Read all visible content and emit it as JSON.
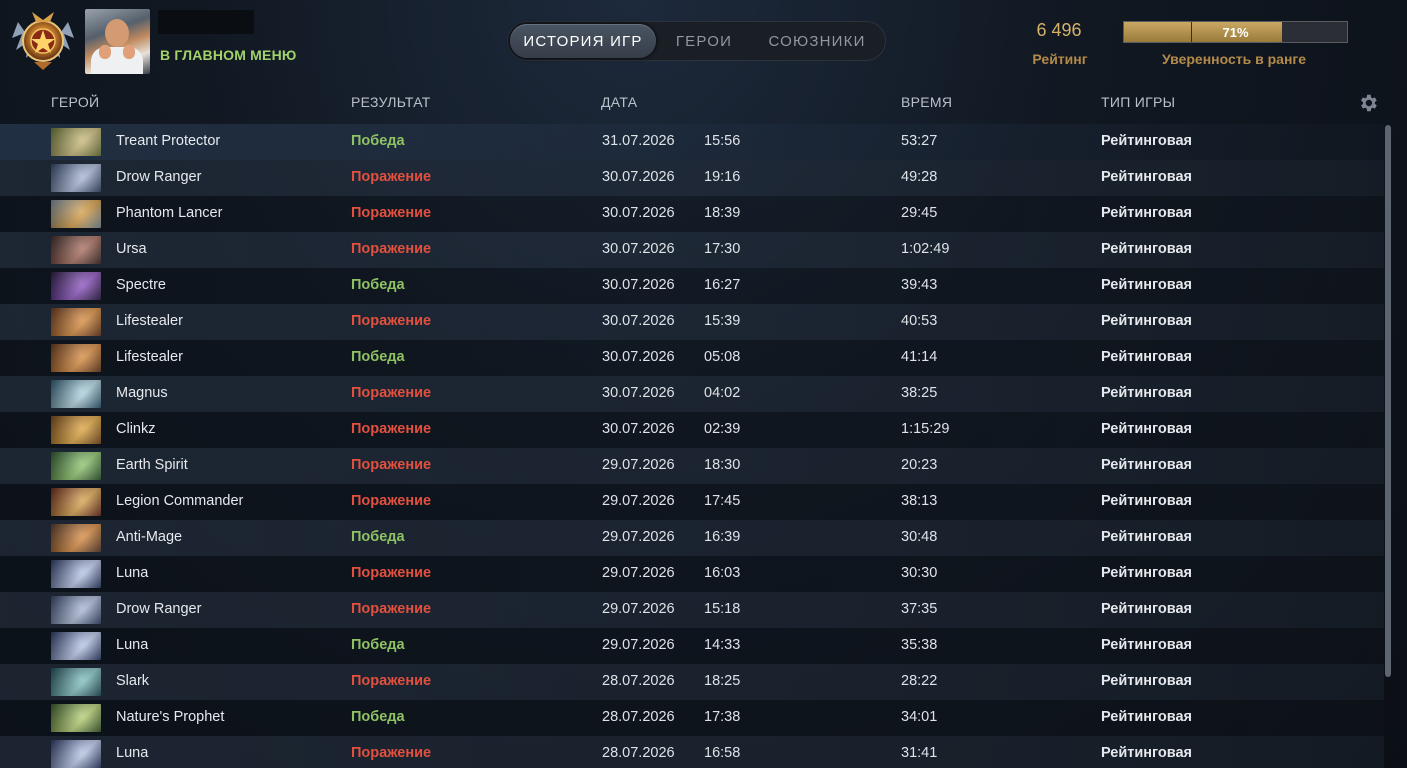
{
  "header": {
    "main_menu_label": "В ГЛАВНОМ МЕНЮ",
    "tabs": [
      {
        "label": "ИСТОРИЯ ИГР",
        "active": true
      },
      {
        "label": "ГЕРОИ",
        "active": false
      },
      {
        "label": "СОЮЗНИКИ",
        "active": false
      }
    ],
    "rating_value": "6 496",
    "rating_label": "Рейтинг",
    "confidence_percent": "71%",
    "confidence_fraction": 0.71,
    "confidence_label": "Уверенность в ранге"
  },
  "table": {
    "columns": {
      "hero": "ГЕРОЙ",
      "result": "РЕЗУЛЬТАТ",
      "date": "ДАТА",
      "duration": "ВРЕМЯ",
      "game_type": "ТИП ИГРЫ"
    },
    "rows": [
      {
        "hero": "Treant Protector",
        "result": "Победа",
        "win": true,
        "date": "31.07.2026",
        "time": "15:56",
        "duration": "53:27",
        "type": "Рейтинговая",
        "colors": [
          "#6f7a3a",
          "#c9b877"
        ]
      },
      {
        "hero": "Drow Ranger",
        "result": "Поражение",
        "win": false,
        "date": "30.07.2026",
        "time": "19:16",
        "duration": "49:28",
        "type": "Рейтинговая",
        "colors": [
          "#33466b",
          "#a9b7d6"
        ]
      },
      {
        "hero": "Phantom Lancer",
        "result": "Поражение",
        "win": false,
        "date": "30.07.2026",
        "time": "18:39",
        "duration": "29:45",
        "type": "Рейтинговая",
        "colors": [
          "#7d93a4",
          "#d89b3f"
        ]
      },
      {
        "hero": "Ursa",
        "result": "Поражение",
        "win": false,
        "date": "30.07.2026",
        "time": "17:30",
        "duration": "1:02:49",
        "type": "Рейтинговая",
        "colors": [
          "#3b2a26",
          "#a86a5a"
        ]
      },
      {
        "hero": "Spectre",
        "result": "Победа",
        "win": true,
        "date": "30.07.2026",
        "time": "16:27",
        "duration": "39:43",
        "type": "Рейтинговая",
        "colors": [
          "#2a1a45",
          "#8a4fbf"
        ]
      },
      {
        "hero": "Lifestealer",
        "result": "Поражение",
        "win": false,
        "date": "30.07.2026",
        "time": "15:39",
        "duration": "40:53",
        "type": "Рейтинговая",
        "colors": [
          "#6b3a1c",
          "#d98a3a"
        ]
      },
      {
        "hero": "Lifestealer",
        "result": "Победа",
        "win": true,
        "date": "30.07.2026",
        "time": "05:08",
        "duration": "41:14",
        "type": "Рейтинговая",
        "colors": [
          "#6b3a1c",
          "#d98a3a"
        ]
      },
      {
        "hero": "Magnus",
        "result": "Поражение",
        "win": false,
        "date": "30.07.2026",
        "time": "04:02",
        "duration": "38:25",
        "type": "Рейтинговая",
        "colors": [
          "#2d5a72",
          "#b0d4e0"
        ]
      },
      {
        "hero": "Clinkz",
        "result": "Поражение",
        "win": false,
        "date": "30.07.2026",
        "time": "02:39",
        "duration": "1:15:29",
        "type": "Рейтинговая",
        "colors": [
          "#7a4a1a",
          "#e0a43a"
        ]
      },
      {
        "hero": "Earth Spirit",
        "result": "Поражение",
        "win": false,
        "date": "29.07.2026",
        "time": "18:30",
        "duration": "20:23",
        "type": "Рейтинговая",
        "colors": [
          "#2f5a2f",
          "#8bc46a"
        ]
      },
      {
        "hero": "Legion Commander",
        "result": "Поражение",
        "win": false,
        "date": "29.07.2026",
        "time": "17:45",
        "duration": "38:13",
        "type": "Рейтинговая",
        "colors": [
          "#6a2a1a",
          "#d9a24a"
        ]
      },
      {
        "hero": "Anti-Mage",
        "result": "Победа",
        "win": true,
        "date": "29.07.2026",
        "time": "16:39",
        "duration": "30:48",
        "type": "Рейтинговая",
        "colors": [
          "#5a3a2a",
          "#d9883a"
        ]
      },
      {
        "hero": "Luna",
        "result": "Поражение",
        "win": false,
        "date": "29.07.2026",
        "time": "16:03",
        "duration": "30:30",
        "type": "Рейтинговая",
        "colors": [
          "#2a3a6a",
          "#b8c6e8"
        ]
      },
      {
        "hero": "Drow Ranger",
        "result": "Поражение",
        "win": false,
        "date": "29.07.2026",
        "time": "15:18",
        "duration": "37:35",
        "type": "Рейтинговая",
        "colors": [
          "#33466b",
          "#a9b7d6"
        ]
      },
      {
        "hero": "Luna",
        "result": "Победа",
        "win": true,
        "date": "29.07.2026",
        "time": "14:33",
        "duration": "35:38",
        "type": "Рейтинговая",
        "colors": [
          "#2a3a6a",
          "#b8c6e8"
        ]
      },
      {
        "hero": "Slark",
        "result": "Поражение",
        "win": false,
        "date": "28.07.2026",
        "time": "18:25",
        "duration": "28:22",
        "type": "Рейтинговая",
        "colors": [
          "#1f4f5a",
          "#7fc0c0"
        ]
      },
      {
        "hero": "Nature's Prophet",
        "result": "Победа",
        "win": true,
        "date": "28.07.2026",
        "time": "17:38",
        "duration": "34:01",
        "type": "Рейтинговая",
        "colors": [
          "#3a5a2a",
          "#b5d070"
        ]
      },
      {
        "hero": "Luna",
        "result": "Поражение",
        "win": false,
        "date": "28.07.2026",
        "time": "16:58",
        "duration": "31:41",
        "type": "Рейтинговая",
        "colors": [
          "#2a3a6a",
          "#b8c6e8"
        ]
      }
    ]
  },
  "icons": {
    "rank": "rank-medal-icon",
    "settings": "gear-icon"
  },
  "colors": {
    "win": "#8fc263",
    "loss": "#e2503f",
    "accent_gold": "#d4b26a",
    "menu_link": "#a2d36a"
  }
}
